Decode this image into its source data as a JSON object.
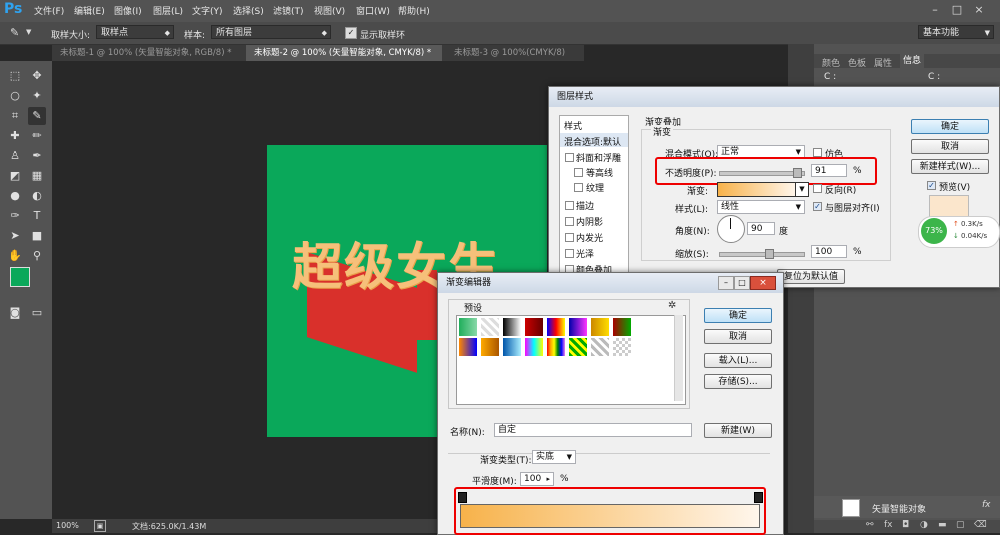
{
  "menubar": {
    "logo": "Ps",
    "items": [
      "文件(F)",
      "编辑(E)",
      "图像(I)",
      "图层(L)",
      "文字(Y)",
      "选择(S)",
      "滤镜(T)",
      "视图(V)",
      "窗口(W)",
      "帮助(H)"
    ],
    "win_min": "–",
    "win_max": "□",
    "win_close": "×"
  },
  "options": {
    "sample_size_label": "取样大小:",
    "sample_size_value": "取样点",
    "sample_label": "样本:",
    "sample_value": "所有图层",
    "show_ring_label": "显示取样环",
    "workspace": "基本功能"
  },
  "tabs": [
    "未标题-1 @ 100% (矢量智能对象, RGB/8) *",
    "未标题-2 @ 100% (矢量智能对象, CMYK/8) *",
    "未标题-3 @ 100%(CMYK/8)"
  ],
  "canvas": {
    "art_text": "超级女生"
  },
  "status": {
    "zoom": "100%",
    "doc": "文档:625.0K/1.43M"
  },
  "right_panel": {
    "tabs": [
      "颜色",
      "色板",
      "属性",
      "信息"
    ],
    "c1": "C :",
    "c2": "C :",
    "layer_name": "矢量智能对象"
  },
  "layer_style": {
    "title": "图层样式",
    "styles_header": "样式",
    "blend_options": "混合选项:默认",
    "items": [
      "斜面和浮雕",
      "等高线",
      "纹理",
      "描边",
      "内阴影",
      "内发光",
      "光泽",
      "颜色叠加"
    ],
    "section_title": "渐变叠加",
    "group_title": "渐变",
    "blend_mode_label": "混合模式(O):",
    "blend_mode_value": "正常",
    "dither_label": "仿色",
    "opacity_label": "不透明度(P):",
    "opacity_value": "91",
    "opacity_unit": "%",
    "gradient_label": "渐变:",
    "reverse_label": "反向(R)",
    "style_label": "样式(L):",
    "style_value": "线性",
    "align_label": "与图层对齐(I)",
    "angle_label": "角度(N):",
    "angle_value": "90",
    "angle_unit": "度",
    "scale_label": "缩放(S):",
    "scale_value": "100",
    "scale_unit": "%",
    "reset_default": "复位为默认值",
    "ok": "确定",
    "cancel": "取消",
    "new_style": "新建样式(W)...",
    "preview_label": "预览(V)",
    "opacity_percent": 91
  },
  "network_widget": {
    "percent": "73%",
    "up": "0.3K/s",
    "down": "0.04K/s"
  },
  "gradient_editor": {
    "title": "渐变编辑器",
    "presets_label": "预设",
    "ok": "确定",
    "cancel": "取消",
    "load": "载入(L)...",
    "save": "存储(S)...",
    "name_label": "名称(N):",
    "name_value": "自定",
    "new_button": "新建(W)",
    "type_label": "渐变类型(T):",
    "type_value": "实底",
    "smooth_label": "平滑度(M):",
    "smooth_value": "100",
    "smooth_unit": "%",
    "gradient_start": "#f7b24a",
    "gradient_end": "#fff6ec"
  },
  "colors": {
    "ps_blue": "#2fa3f0",
    "artboard": "#0aa85a",
    "art_text": "#f6c07a",
    "shadow": "#d9302b",
    "highlight_red": "#e00000",
    "fg_swatch": "#0aa85a"
  }
}
